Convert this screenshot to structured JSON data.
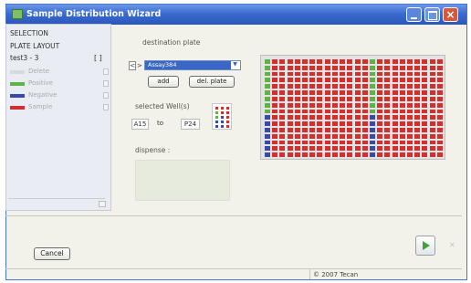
{
  "window": {
    "title": "Sample Distribution Wizard"
  },
  "left_panel": {
    "selection_label": "SELECTION",
    "layout_label": "PLATE LAYOUT",
    "plate_label": "test3 - 3",
    "plate_bracket": "[ ]",
    "items": [
      {
        "label": "Delete",
        "color": "#d7d9dd"
      },
      {
        "label": "Positive",
        "color": "#5fb248"
      },
      {
        "label": "Negative",
        "color": "#3949a8"
      },
      {
        "label": "Sample",
        "color": "#d22f2f"
      }
    ]
  },
  "destination": {
    "label": "destination plate",
    "prev_symbol": "<",
    "next_symbol": ">",
    "selected_plate": "Assay384",
    "add_label": "add",
    "delete_label": "del. plate"
  },
  "wells": {
    "label": "selected Well(s)",
    "from": "A15",
    "to_label": "to",
    "to": "P24"
  },
  "dispense": {
    "label": "dispense :"
  },
  "plate_grid": {
    "rows": 16,
    "columns": 24,
    "colors": {
      "positive": "#5fb248",
      "negative": "#3949a8",
      "sample": "#d22f2f",
      "empty": "#e3e3e3"
    }
  },
  "footer": {
    "cancel_label": "Cancel",
    "copyright": "© 2007 Tecan"
  }
}
